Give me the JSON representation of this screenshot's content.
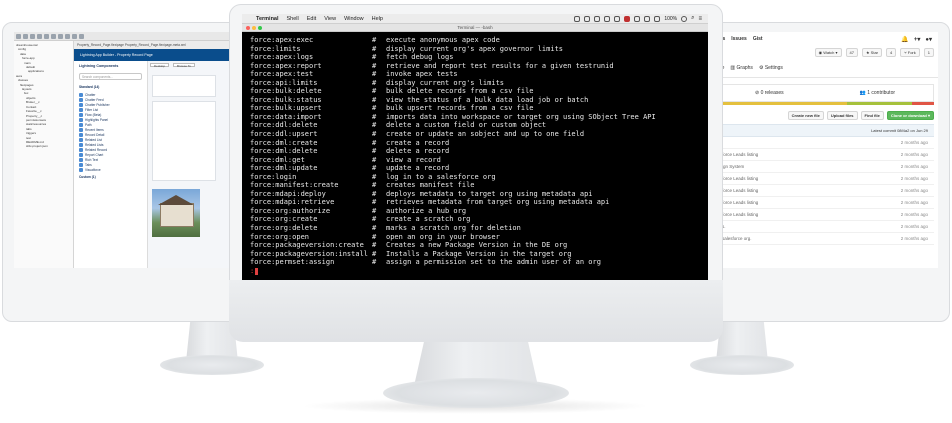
{
  "colors": {
    "terminal_bg": "#000000",
    "terminal_fg": "#e9e9e9",
    "prompt_red": "#e04040",
    "lab_blue": "#0a4d8c",
    "lab_button_blue": "#0070d2",
    "gh_green": "#5cb85c",
    "traffic_red": "#fc605b",
    "traffic_yellow": "#fdbc40",
    "traffic_green": "#34c84a"
  },
  "left_screen": {
    "tabs": "Property_Record_Page.flexipage    Property_Record_Page.flexipage-meta.xml",
    "header_title": "Lightning App Builder - Property Record Page",
    "palette": {
      "title": "Lightning Components",
      "search_placeholder": "Search components...",
      "standard_section": "Standard (14)",
      "items": [
        "Chatter",
        "Chatter Feed",
        "Chatter Publisher",
        "Filter List",
        "Flow (Beta)",
        "Highlights Panel",
        "Path",
        "Recent Items",
        "Record Detail",
        "Related List",
        "Related Lists",
        "Related Record",
        "Report Chart",
        "Rich Text",
        "Tabs",
        "Visualforce"
      ],
      "custom_section": "Custom (1)",
      "footer": "Get more on the AppExchange"
    },
    "canvas": {
      "device": "Desktop",
      "browse": "Browse To"
    },
    "tree": [
      "dreamhouse-lwc",
      "config",
      "data",
      "force-app",
      "main",
      "default",
      "applications",
      "aura",
      "classes",
      "flexipages",
      "layouts",
      "lwc",
      "objects",
      "Broker__c",
      "Contact",
      "Favorite__c",
      "Property__c",
      "permissionsets",
      "staticresources",
      "tabs",
      "triggers",
      "test",
      "README.md",
      "sfdx-project.json"
    ]
  },
  "terminal": {
    "menubar": {
      "app": "Terminal",
      "items": [
        "Shell",
        "Edit",
        "View",
        "Window",
        "Help"
      ],
      "battery": "100%"
    },
    "window_title": "Terminal — -bash",
    "lines": [
      {
        "cmd": "force:apex:exec",
        "desc": "execute anonymous apex code"
      },
      {
        "cmd": "force:limits",
        "desc": "display current org's apex governor limits"
      },
      {
        "cmd": "force:apex:logs",
        "desc": "fetch debug logs"
      },
      {
        "cmd": "force:apex:report",
        "desc": "retrieve and report test results for a given testrunid"
      },
      {
        "cmd": "force:apex:test",
        "desc": "invoke apex tests"
      },
      {
        "cmd": "force:api:limits",
        "desc": "display current org's limits"
      },
      {
        "cmd": "force:bulk:delete",
        "desc": "bulk delete records from a csv file"
      },
      {
        "cmd": "force:bulk:status",
        "desc": "view the status of a bulk data load job or batch"
      },
      {
        "cmd": "force:bulk:upsert",
        "desc": "bulk upsert records from a csv file"
      },
      {
        "cmd": "force:data:import",
        "desc": "imports data into workspace or target org using SObject Tree API"
      },
      {
        "cmd": "force:ddl:delete",
        "desc": "delete a custom field or custom object"
      },
      {
        "cmd": "force:ddl:upsert",
        "desc": "create or update an sobject and up to one field"
      },
      {
        "cmd": "force:dml:create",
        "desc": "create a record"
      },
      {
        "cmd": "force:dml:delete",
        "desc": "delete a record"
      },
      {
        "cmd": "force:dml:get",
        "desc": "view a record"
      },
      {
        "cmd": "force:dml:update",
        "desc": "update a record"
      },
      {
        "cmd": "force:login",
        "desc": "log in to a salesforce org"
      },
      {
        "cmd": "force:manifest:create",
        "desc": "creates manifest file"
      },
      {
        "cmd": "force:mdapi:deploy",
        "desc": "deploys metadata to target org using metadata api"
      },
      {
        "cmd": "force:mdapi:retrieve",
        "desc": "retrieves metadata from target org using metadata api"
      },
      {
        "cmd": "force:org:authorize",
        "desc": "authorize a hub org"
      },
      {
        "cmd": "force:org:create",
        "desc": "create a scratch org"
      },
      {
        "cmd": "force:org:delete",
        "desc": "marks a scratch org for deletion"
      },
      {
        "cmd": "force:org:open",
        "desc": "open an org in your browser"
      },
      {
        "cmd": "force:packageversion:create",
        "desc": "Creates a new Package Version in the DE org"
      },
      {
        "cmd": "force:packageversion:install",
        "desc": "Installs a Package Version in the target org"
      },
      {
        "cmd": "force:permset:assign",
        "desc": "assign a permission set to the admin user of an org"
      }
    ],
    "hash": "#",
    "prompt": ":"
  },
  "right_screen": {
    "nav": [
      "sts",
      "Issues",
      "Gist"
    ],
    "watch": "Watch",
    "watch_count": "47",
    "star": "Star",
    "star_count": "4",
    "fork": "Fork",
    "fork_count": "1",
    "tabs": [
      "ise",
      "Graphs",
      "Settings"
    ],
    "releases": "0 releases",
    "contributors": "1 contributor",
    "actions": [
      "Create new file",
      "Upload files",
      "Find file",
      "Clone or download"
    ],
    "latest_commit": "Latest commit 08f4a2 on Jun 29",
    "rows": [
      {
        "msg": "",
        "age": "2 months ago"
      },
      {
        "msg": "force Leads listing",
        "age": "2 months ago"
      },
      {
        "msg": "ign System",
        "age": "2 months ago"
      },
      {
        "msg": "force Leads listing",
        "age": "2 months ago"
      },
      {
        "msg": "force Leads listing",
        "age": "2 months ago"
      },
      {
        "msg": "force Leads listing",
        "age": "2 months ago"
      },
      {
        "msg": "force Leads listing",
        "age": "2 months ago"
      },
      {
        "msg": "s.",
        "age": "2 months ago"
      },
      {
        "msg": "salesforce org.",
        "age": "2 months ago"
      }
    ]
  }
}
